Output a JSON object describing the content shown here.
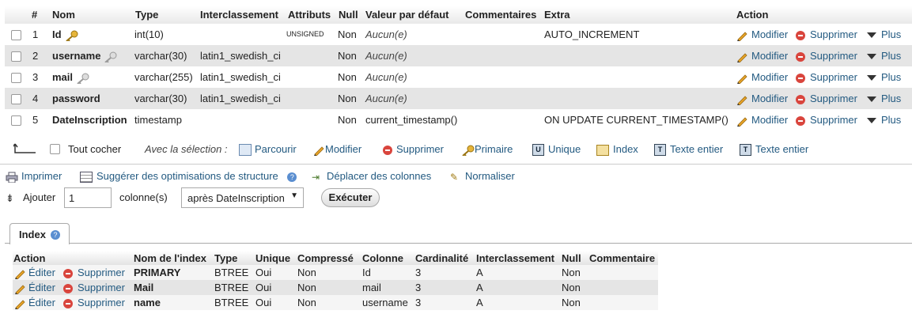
{
  "columns_header": {
    "num": "#",
    "name": "Nom",
    "type": "Type",
    "collation": "Interclassement",
    "attributes": "Attributs",
    "null": "Null",
    "default": "Valeur par défaut",
    "comments": "Commentaires",
    "extra": "Extra",
    "action": "Action"
  },
  "rows": [
    {
      "num": "1",
      "name": "Id",
      "type": "int(10)",
      "collation": "",
      "attributes": "UNSIGNED",
      "null": "Non",
      "default": "Aucun(e)",
      "extra": "AUTO_INCREMENT",
      "key": "primary"
    },
    {
      "num": "2",
      "name": "username",
      "type": "varchar(30)",
      "collation": "latin1_swedish_ci",
      "attributes": "",
      "null": "Non",
      "default": "Aucun(e)",
      "extra": "",
      "key": "index"
    },
    {
      "num": "3",
      "name": "mail",
      "type": "varchar(255)",
      "collation": "latin1_swedish_ci",
      "attributes": "",
      "null": "Non",
      "default": "Aucun(e)",
      "extra": "",
      "key": "index"
    },
    {
      "num": "4",
      "name": "password",
      "type": "varchar(30)",
      "collation": "latin1_swedish_ci",
      "attributes": "",
      "null": "Non",
      "default": "Aucun(e)",
      "extra": "",
      "key": ""
    },
    {
      "num": "5",
      "name": "DateInscription",
      "type": "timestamp",
      "collation": "",
      "attributes": "",
      "null": "Non",
      "default": "current_timestamp()",
      "extra": "ON UPDATE CURRENT_TIMESTAMP()",
      "key": ""
    }
  ],
  "row_actions": {
    "modify": "Modifier",
    "delete": "Supprimer",
    "more": "Plus"
  },
  "selection_bar": {
    "check_all": "Tout cocher",
    "with_selection": "Avec la sélection :",
    "browse": "Parcourir",
    "modify": "Modifier",
    "delete": "Supprimer",
    "primary": "Primaire",
    "unique": "Unique",
    "index": "Index",
    "fulltext1": "Texte entier",
    "fulltext2": "Texte entier"
  },
  "tools": {
    "print": "Imprimer",
    "suggest": "Suggérer des optimisations de structure",
    "move": "Déplacer des colonnes",
    "normalize": "Normaliser"
  },
  "add_bar": {
    "add": "Ajouter",
    "count": "1",
    "columns": "colonne(s)",
    "position": "après DateInscription",
    "execute": "Exécuter"
  },
  "index_section": {
    "title": "Index",
    "header": {
      "action": "Action",
      "name": "Nom de l'index",
      "type": "Type",
      "unique": "Unique",
      "packed": "Compressé",
      "column": "Colonne",
      "cardinality": "Cardinalité",
      "collation": "Interclassement",
      "null": "Null",
      "comment": "Commentaire"
    },
    "edit": "Éditer",
    "delete": "Supprimer",
    "rows": [
      {
        "name": "PRIMARY",
        "type": "BTREE",
        "unique": "Oui",
        "packed": "Non",
        "column": "Id",
        "cardinality": "3",
        "collation": "A",
        "null": "Non"
      },
      {
        "name": "Mail",
        "type": "BTREE",
        "unique": "Oui",
        "packed": "Non",
        "column": "mail",
        "cardinality": "3",
        "collation": "A",
        "null": "Non"
      },
      {
        "name": "name",
        "type": "BTREE",
        "unique": "Oui",
        "packed": "Non",
        "column": "username",
        "cardinality": "3",
        "collation": "A",
        "null": "Non"
      }
    ]
  },
  "colors": {
    "link": "#235a81",
    "row_alt": "#e5e5e5",
    "delete_red": "#d9453d"
  }
}
